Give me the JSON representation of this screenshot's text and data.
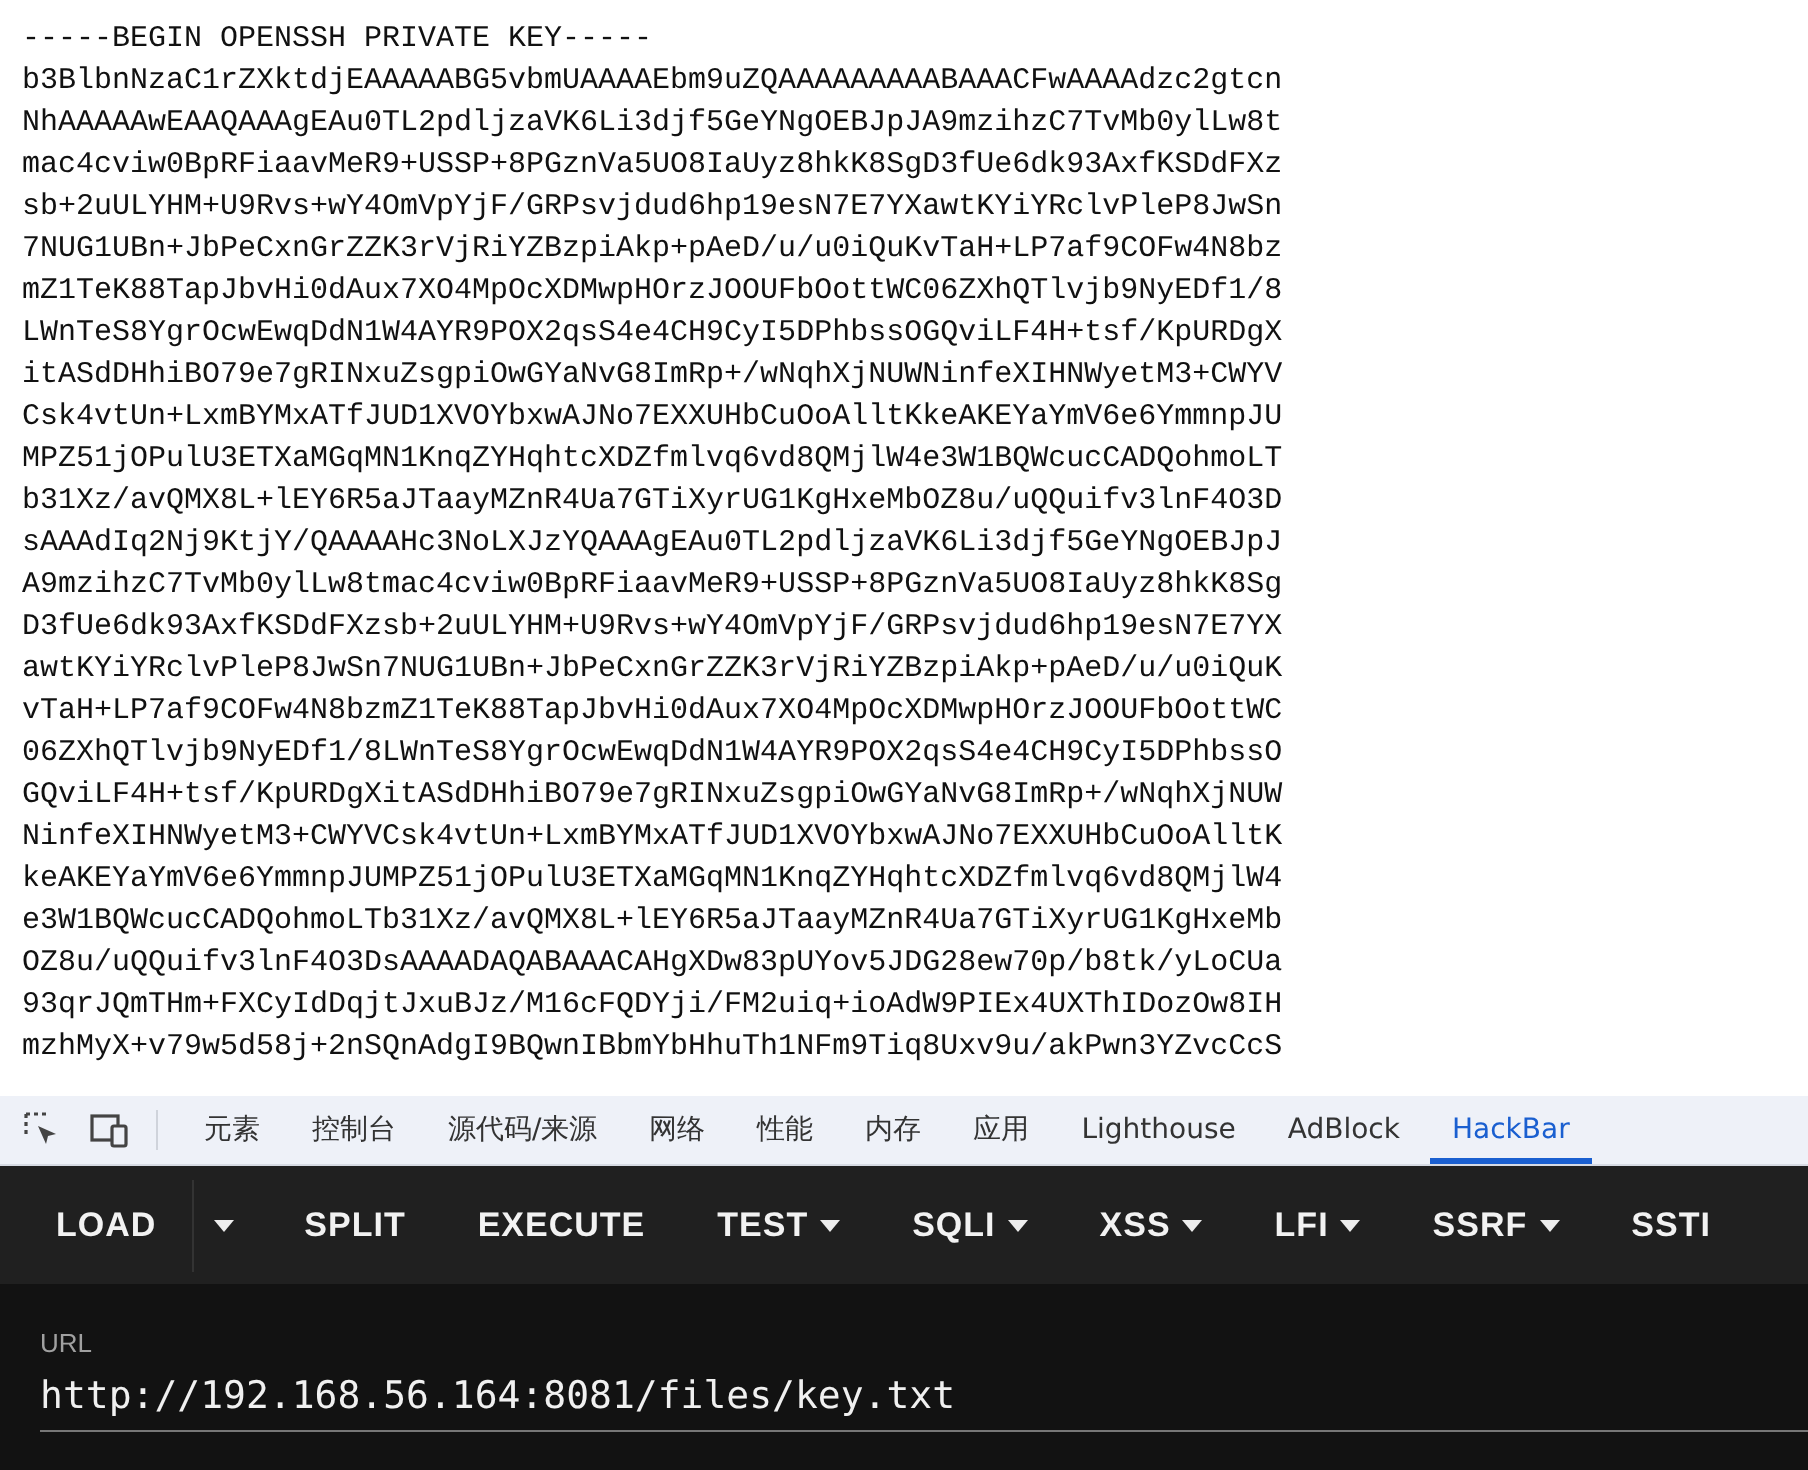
{
  "document": {
    "header": "-----BEGIN OPENSSH PRIVATE KEY-----",
    "lines": [
      "b3BlbnNzaC1rZXktdjEAAAAABG5vbmUAAAAEbm9uZQAAAAAAAAABAAACFwAAAAdzc2gtcn",
      "NhAAAAAwEAAQAAAgEAu0TL2pdljzaVK6Li3djf5GeYNgOEBJpJA9mzihzC7TvMb0ylLw8t",
      "mac4cviw0BpRFiaavMeR9+USSP+8PGznVa5UO8IaUyz8hkK8SgD3fUe6dk93AxfKSDdFXz",
      "sb+2uULYHM+U9Rvs+wY4OmVpYjF/GRPsvjdud6hp19esN7E7YXawtKYiYRclvPleP8JwSn",
      "7NUG1UBn+JbPeCxnGrZZK3rVjRiYZBzpiAkp+pAeD/u/u0iQuKvTaH+LP7af9COFw4N8bz",
      "mZ1TeK88TapJbvHi0dAux7XO4MpOcXDMwpHOrzJOOUFbOottWC06ZXhQTlvjb9NyEDf1/8",
      "LWnTeS8YgrOcwEwqDdN1W4AYR9POX2qsS4e4CH9CyI5DPhbssOGQviLF4H+tsf/KpURDgX",
      "itASdDHhiBO79e7gRINxuZsgpiOwGYaNvG8ImRp+/wNqhXjNUWNinfeXIHNWyetM3+CWYV",
      "Csk4vtUn+LxmBYMxATfJUD1XVOYbxwAJNo7EXXUHbCuOoAlltKkeAKEYaYmV6e6YmmnpJU",
      "MPZ51jOPulU3ETXaMGqMN1KnqZYHqhtcXDZfmlvq6vd8QMjlW4e3W1BQWcucCADQohmoLT",
      "b31Xz/avQMX8L+lEY6R5aJTaayMZnR4Ua7GTiXyrUG1KgHxeMbOZ8u/uQQuifv3lnF4O3D",
      "sAAAdIq2Nj9KtjY/QAAAAHc3NoLXJzYQAAAgEAu0TL2pdljzaVK6Li3djf5GeYNgOEBJpJ",
      "A9mzihzC7TvMb0ylLw8tmac4cviw0BpRFiaavMeR9+USSP+8PGznVa5UO8IaUyz8hkK8Sg",
      "D3fUe6dk93AxfKSDdFXzsb+2uULYHM+U9Rvs+wY4OmVpYjF/GRPsvjdud6hp19esN7E7YX",
      "awtKYiYRclvPleP8JwSn7NUG1UBn+JbPeCxnGrZZK3rVjRiYZBzpiAkp+pAeD/u/u0iQuK",
      "vTaH+LP7af9COFw4N8bzmZ1TeK88TapJbvHi0dAux7XO4MpOcXDMwpHOrzJOOUFbOottWC",
      "06ZXhQTlvjb9NyEDf1/8LWnTeS8YgrOcwEwqDdN1W4AYR9POX2qsS4e4CH9CyI5DPhbssO",
      "GQviLF4H+tsf/KpURDgXitASdDHhiBO79e7gRINxuZsgpiOwGYaNvG8ImRp+/wNqhXjNUW",
      "NinfeXIHNWyetM3+CWYVCsk4vtUn+LxmBYMxATfJUD1XVOYbxwAJNo7EXXUHbCuOoAlltK",
      "keAKEYaYmV6e6YmmnpJUMPZ51jOPulU3ETXaMGqMN1KnqZYHqhtcXDZfmlvq6vd8QMjlW4",
      "e3W1BQWcucCADQohmoLTb31Xz/avQMX8L+lEY6R5aJTaayMZnR4Ua7GTiXyrUG1KgHxeMb",
      "OZ8u/uQQuifv3lnF4O3DsAAAADAQABAAACAHgXDw83pUYov5JDG28ew70p/b8tk/yLoCUa",
      "93qrJQmTHm+FXCyIdDqjtJxuBJz/M16cFQDYji/FM2uiq+ioAdW9PIEx4UXThIDozOw8IH",
      "mzhMyX+v79w5d58j+2nSQnAdgI9BQwnIBbmYbHhuTh1NFm9Tiq8Uxv9u/akPwn3YZvcCcS"
    ]
  },
  "devtools": {
    "tabs": [
      {
        "label": "元素",
        "selected": false
      },
      {
        "label": "控制台",
        "selected": false
      },
      {
        "label": "源代码/来源",
        "selected": false
      },
      {
        "label": "网络",
        "selected": false
      },
      {
        "label": "性能",
        "selected": false
      },
      {
        "label": "内存",
        "selected": false
      },
      {
        "label": "应用",
        "selected": false
      },
      {
        "label": "Lighthouse",
        "selected": false
      },
      {
        "label": "AdBlock",
        "selected": false
      },
      {
        "label": "HackBar",
        "selected": true
      }
    ]
  },
  "hackbar": {
    "buttons": [
      {
        "label": "LOAD",
        "kind": "split"
      },
      {
        "label": "SPLIT",
        "kind": "plain"
      },
      {
        "label": "EXECUTE",
        "kind": "plain"
      },
      {
        "label": "TEST",
        "kind": "menu"
      },
      {
        "label": "SQLI",
        "kind": "menu"
      },
      {
        "label": "XSS",
        "kind": "menu"
      },
      {
        "label": "LFI",
        "kind": "menu"
      },
      {
        "label": "SSRF",
        "kind": "menu"
      },
      {
        "label": "SSTI",
        "kind": "plain"
      }
    ],
    "url_label": "URL",
    "url_value": "http://192.168.56.164:8081/files/key.txt"
  }
}
